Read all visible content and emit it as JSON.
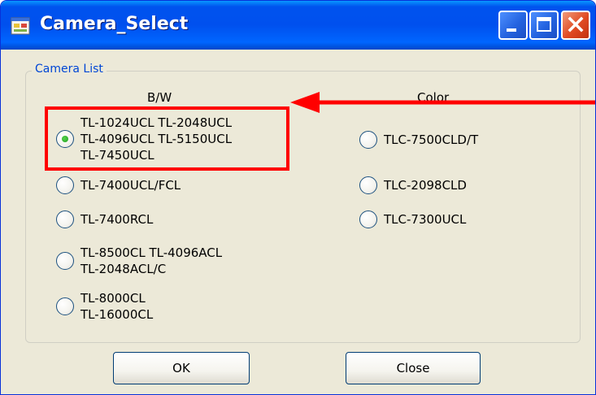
{
  "window": {
    "title": "Camera_Select",
    "icon": "app-window-icon",
    "controls": {
      "minimize_icon": "minimize-icon",
      "maximize_icon": "maximize-icon",
      "close_icon": "close-icon"
    }
  },
  "group": {
    "label": "Camera List",
    "bw_header": "B/W",
    "color_header": "Color"
  },
  "bw_options": [
    {
      "label": "TL-1024UCL TL-2048UCL\nTL-4096UCL TL-5150UCL\nTL-7450UCL",
      "checked": true
    },
    {
      "label": "TL-7400UCL/FCL",
      "checked": false
    },
    {
      "label": "TL-7400RCL",
      "checked": false
    },
    {
      "label": "TL-8500CL TL-4096ACL\nTL-2048ACL/C",
      "checked": false
    },
    {
      "label": "TL-8000CL\nTL-16000CL",
      "checked": false
    }
  ],
  "color_options": [
    {
      "label": "TLC-7500CLD/T",
      "checked": false
    },
    {
      "label": "TLC-2098CLD",
      "checked": false
    },
    {
      "label": "TLC-7300UCL",
      "checked": false
    }
  ],
  "buttons": {
    "ok": "OK",
    "close": "Close"
  },
  "annotation": {
    "color": "#ff0000"
  }
}
